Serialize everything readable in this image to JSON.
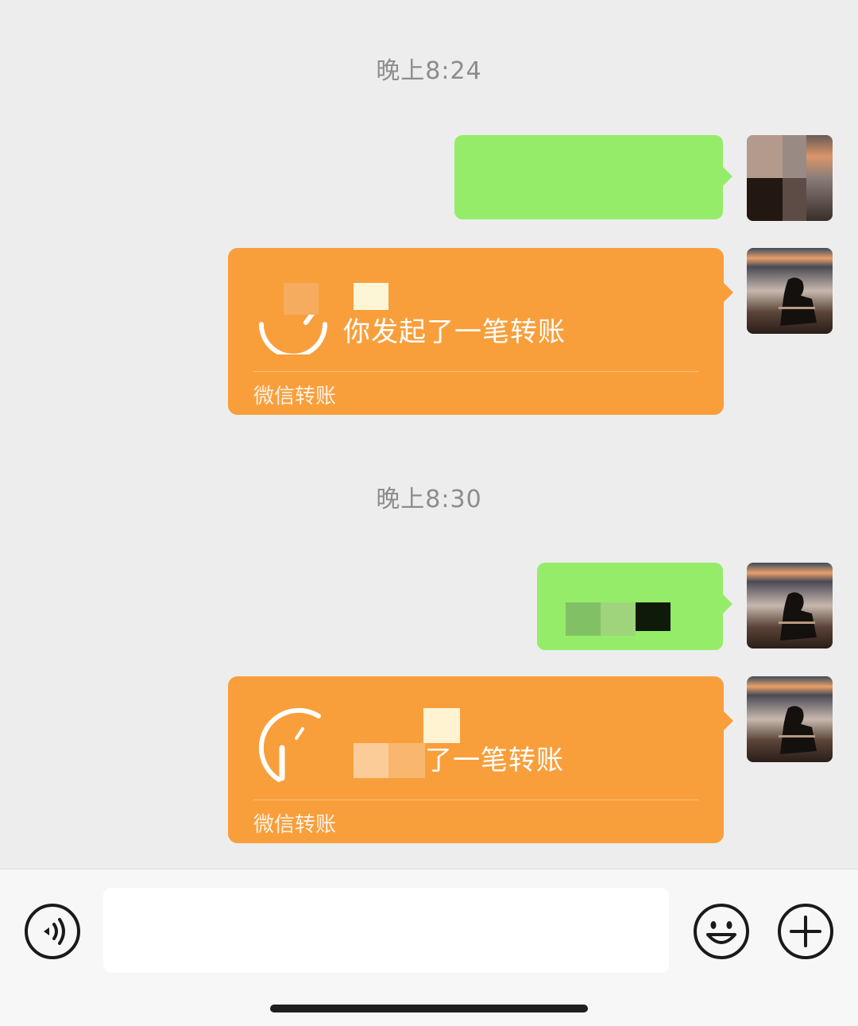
{
  "messages": [
    {
      "type": "timestamp",
      "text": "晚上8:24"
    },
    {
      "type": "text",
      "sender": "self",
      "content": ""
    },
    {
      "type": "transfer",
      "sender": "self",
      "title": "你发起了一笔转账",
      "footer": "微信转账"
    },
    {
      "type": "timestamp",
      "text": "晚上8:30"
    },
    {
      "type": "text",
      "sender": "self",
      "content": ""
    },
    {
      "type": "transfer",
      "sender": "self",
      "title": "了一笔转账",
      "footer": "微信转账"
    }
  ],
  "input_bar": {
    "input_value": "",
    "voice_icon": "voice-icon",
    "emoji_icon": "emoji-icon",
    "plus_icon": "plus-icon"
  },
  "colors": {
    "background": "#ededed",
    "self_bubble": "#95ec69",
    "transfer_card": "#f89f3c"
  }
}
